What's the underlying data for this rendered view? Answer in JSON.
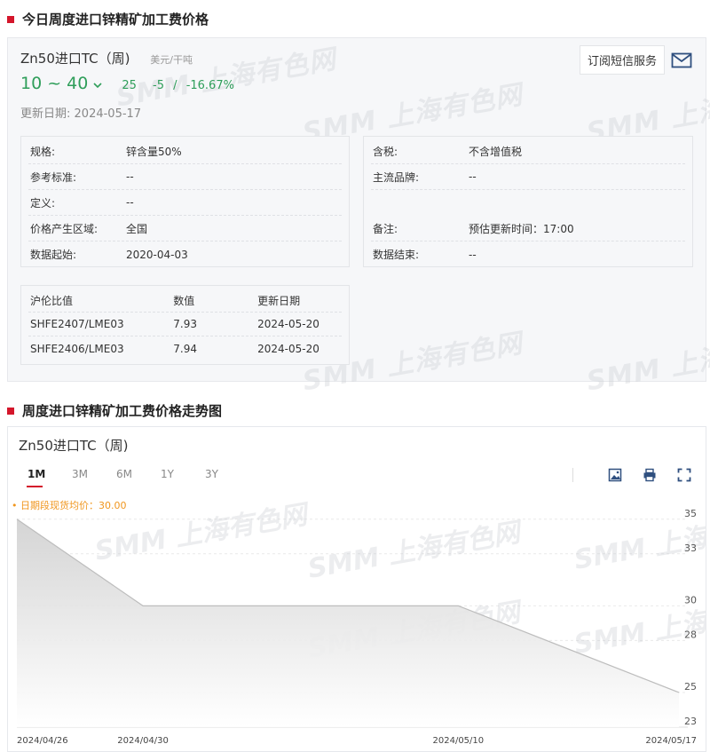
{
  "section1": {
    "title": "今日周度进口锌精矿加工费价格"
  },
  "product": {
    "name": "Zn50进口TC（周)",
    "unit": "美元/干吨",
    "price_range": "10 ~ 40",
    "mid": "25",
    "change": "-5",
    "change_sep": "/",
    "change_pct": "-16.67%",
    "update_label": "更新日期:",
    "update_date": "2024-05-17",
    "subscribe_label": "订阅短信服务"
  },
  "watermark": {
    "text": "SMM 上海有色网"
  },
  "specs_left": [
    {
      "k": "规格:",
      "v": "锌含量50%"
    },
    {
      "k": "参考标准:",
      "v": "--"
    },
    {
      "k": "定义:",
      "v": "--"
    },
    {
      "k": "价格产生区域:",
      "v": "全国"
    },
    {
      "k": "数据起始:",
      "v": "2020-04-03"
    }
  ],
  "specs_right": [
    {
      "k": "含税:",
      "v": "不含增值税"
    },
    {
      "k": "主流品牌:",
      "v": "--"
    },
    {
      "k": "",
      "v": ""
    },
    {
      "k": "备注:",
      "v": "预估更新时间：17:00"
    },
    {
      "k": "数据结束:",
      "v": "--"
    }
  ],
  "ratio_table": {
    "headers": [
      "沪伦比值",
      "数值",
      "更新日期"
    ],
    "rows": [
      [
        "SHFE2407/LME03",
        "7.93",
        "2024-05-20"
      ],
      [
        "SHFE2406/LME03",
        "7.94",
        "2024-05-20"
      ]
    ]
  },
  "section2": {
    "title": "周度进口锌精矿加工费价格走势图"
  },
  "chart_panel": {
    "title": "Zn50进口TC（周)",
    "ranges": [
      "1M",
      "3M",
      "6M",
      "1Y",
      "3Y"
    ],
    "active_range": "1M",
    "avg_label": "• 日期段现货均价：30.00"
  },
  "colors": {
    "accent": "#d4162b",
    "green": "#2f9e5a",
    "orange": "#f0961e"
  },
  "chart_data": {
    "type": "area",
    "x": [
      "2024/04/26",
      "2024/04/30",
      "2024/05/10",
      "2024/05/17"
    ],
    "values": [
      35,
      30,
      30,
      25
    ],
    "y_ticks": [
      35,
      33,
      30,
      28,
      25,
      23
    ],
    "ylim": [
      23,
      35.5
    ],
    "grid": true,
    "y_axis_side": "right"
  }
}
